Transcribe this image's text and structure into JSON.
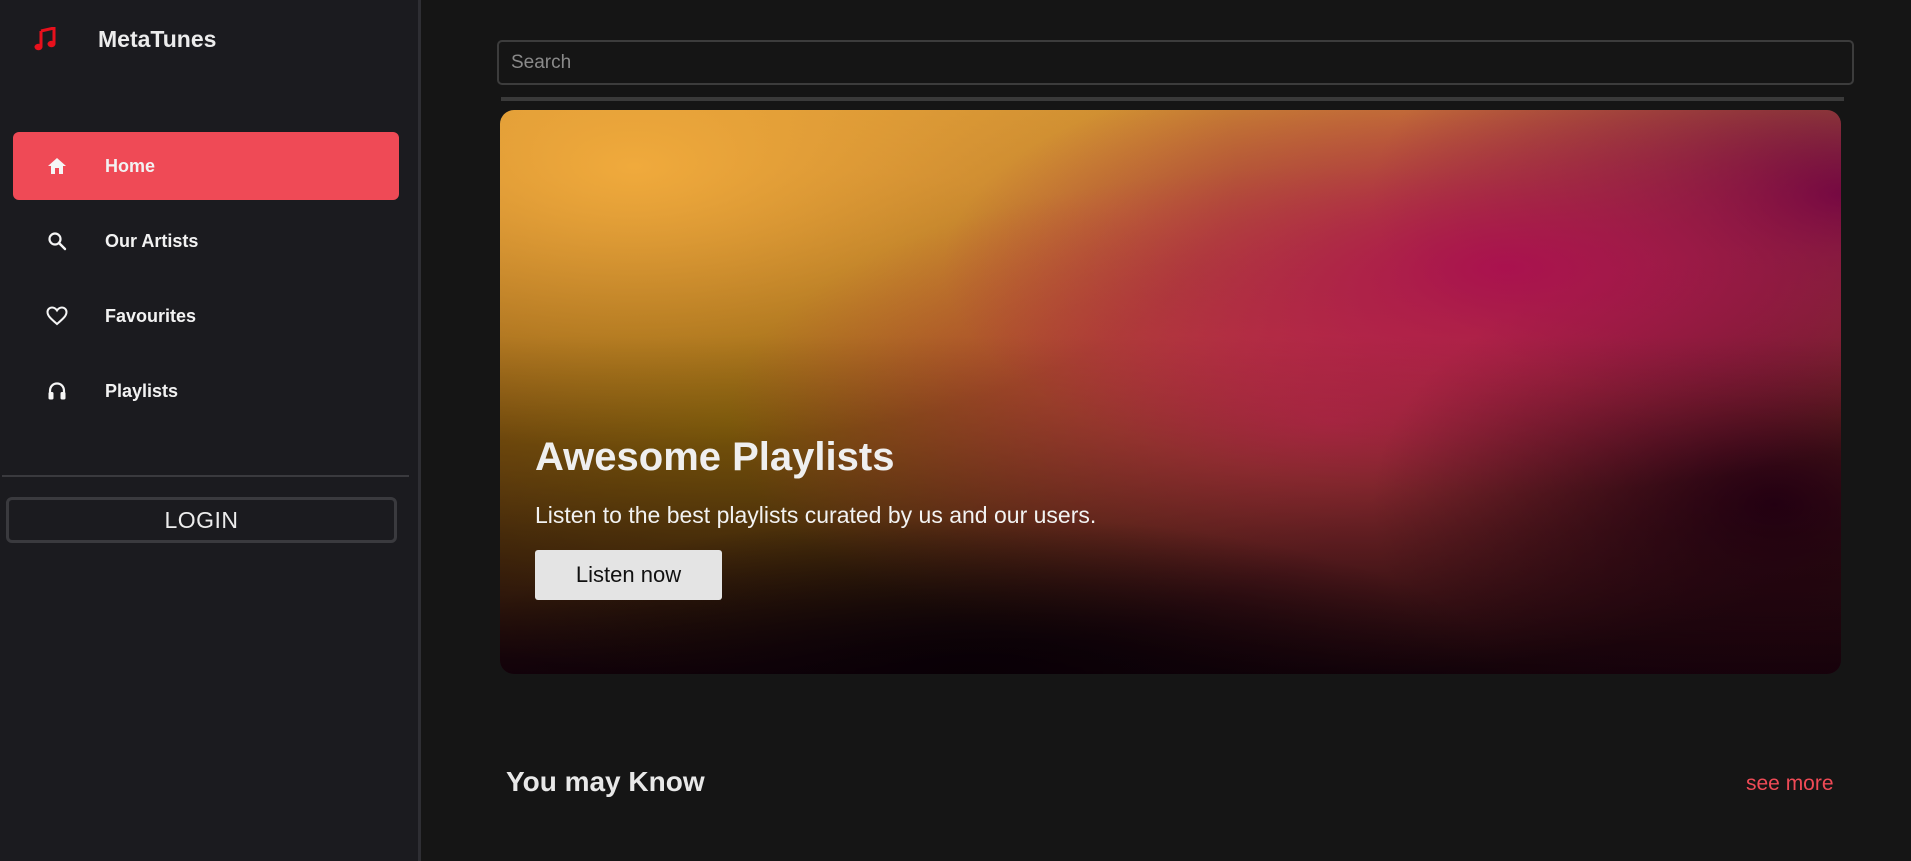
{
  "brand": {
    "title": "MetaTunes",
    "icon": "music-note-icon",
    "icon_color": "#e8101c"
  },
  "sidebar": {
    "items": [
      {
        "label": "Home",
        "icon": "home-icon",
        "active": true
      },
      {
        "label": "Our Artists",
        "icon": "search-icon",
        "active": false
      },
      {
        "label": "Favourites",
        "icon": "heart-icon",
        "active": false
      },
      {
        "label": "Playlists",
        "icon": "headphones-icon",
        "active": false
      }
    ],
    "login_label": "LOGIN"
  },
  "search": {
    "placeholder": "Search",
    "value": ""
  },
  "hero": {
    "title": "Awesome Playlists",
    "subtitle": "Listen to the best playlists curated by us and our users.",
    "button_label": "Listen now"
  },
  "section": {
    "title": "You may Know",
    "see_more": "see more"
  },
  "colors": {
    "accent": "#ef4a56",
    "background": "#151515",
    "sidebar": "#1b1b1f"
  }
}
